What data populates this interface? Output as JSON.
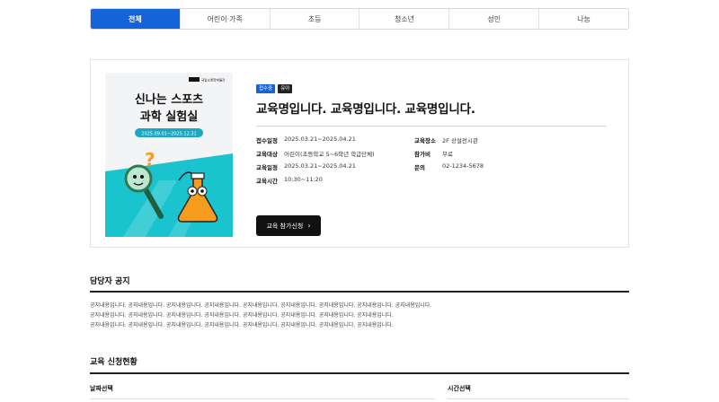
{
  "tabs": [
    {
      "label": "전체",
      "active": true
    },
    {
      "label": "어린이·가족",
      "active": false
    },
    {
      "label": "초등",
      "active": false
    },
    {
      "label": "청소년",
      "active": false
    },
    {
      "label": "성인",
      "active": false
    },
    {
      "label": "나눔",
      "active": false
    }
  ],
  "poster": {
    "logo_text": "국립소록학박물관",
    "headline_1": "신나는 스포츠",
    "headline_2": "과학 실험실",
    "date_range": "2025.09.01~2025.12.31",
    "colors": {
      "teal": "#19c4cf",
      "orange": "#f59b1e",
      "green": "#3fbf8a",
      "pill": "#1aa9c4"
    }
  },
  "program": {
    "badges": [
      "접수중",
      "유아"
    ],
    "title": "교육명입니다. 교육명입니다. 교육명입니다.",
    "details_left": [
      {
        "label": "접수일정",
        "value": "2025.03.21~2025.04.21"
      },
      {
        "label": "교육대상",
        "value": "어린이(초등학교 5~6학년 학급단체)"
      },
      {
        "label": "교육일정",
        "value": "2025.03.21~2025.04.21"
      },
      {
        "label": "교육시간",
        "value": "10:30~11:20"
      }
    ],
    "details_right": [
      {
        "label": "교육장소",
        "value": "2F 상설전시관"
      },
      {
        "label": "참가비",
        "value": "무료"
      },
      {
        "label": "문의",
        "value": "02-1234-5678"
      }
    ],
    "apply_label": "교육 참가신청",
    "apply_icon": "chevron-right-icon"
  },
  "notice": {
    "title": "담당자 공지",
    "lines": [
      "공지내용입니다. 공지내용입니다. 공지내용입니다. 공지내용입니다. 공지내용입니다. 공지내용입니다. 공지내용입니다. 공지내용입니다. 공지내용입니다.",
      "공지내용입니다. 공지내용입니다. 공지내용입니다. 공지내용입니다. 공지내용입니다. 공지내용입니다. 공지내용입니다. 공지내용입니다.",
      "공지내용입니다. 공지내용입니다. 공지내용입니다. 공지내용입니다. 공지내용입니다. 공지내용입니다. 공지내용입니다. 공지내용입니다."
    ]
  },
  "status": {
    "title": "교육 신청현황",
    "date_label": "날짜선택",
    "time_label": "시간선택"
  },
  "colors": {
    "accent": "#1463d8",
    "dark": "#111111"
  }
}
